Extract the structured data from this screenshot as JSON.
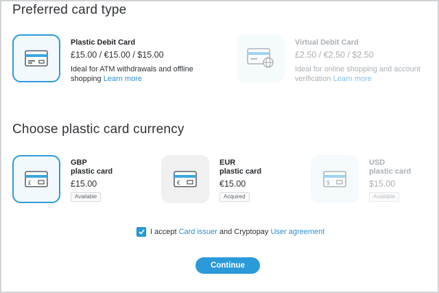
{
  "sections": {
    "card_type_title": "Preferred card type",
    "currency_title": "Choose plastic card currency"
  },
  "card_types": [
    {
      "name": "Plastic Debit Card",
      "price": "£15.00 / €15.00 / $15.00",
      "desc": "Ideal for ATM withdrawals and offline shopping",
      "link": "Learn more",
      "state": "selected",
      "icon": "plastic-card-icon"
    },
    {
      "name": "Virtual Debit Card",
      "price": "£2.50 / €2.50 / $2.50",
      "desc": "Ideal for online shopping and account verification",
      "link": "Learn more",
      "state": "disabled",
      "icon": "virtual-card-icon"
    }
  ],
  "currencies": [
    {
      "code": "GBP",
      "label": "plastic card",
      "price": "£15.00",
      "status": "Available",
      "symbol": "£",
      "state": "selected"
    },
    {
      "code": "EUR",
      "label": "plastic card",
      "price": "€15.00",
      "status": "Acquired",
      "symbol": "€",
      "state": "acquired"
    },
    {
      "code": "USD",
      "label": "plastic card",
      "price": "$15.00",
      "status": "Available",
      "symbol": "$",
      "state": "disabled"
    }
  ],
  "agreement": {
    "checked": true,
    "prefix": "I accept ",
    "link1": "Card issuer",
    "middle": " and Cryptopay ",
    "link2": "User agreement"
  },
  "continue_label": "Continue",
  "colors": {
    "accent": "#2a9ad9",
    "link": "#2a8fd0",
    "card_stripe": "#3aa6de"
  }
}
